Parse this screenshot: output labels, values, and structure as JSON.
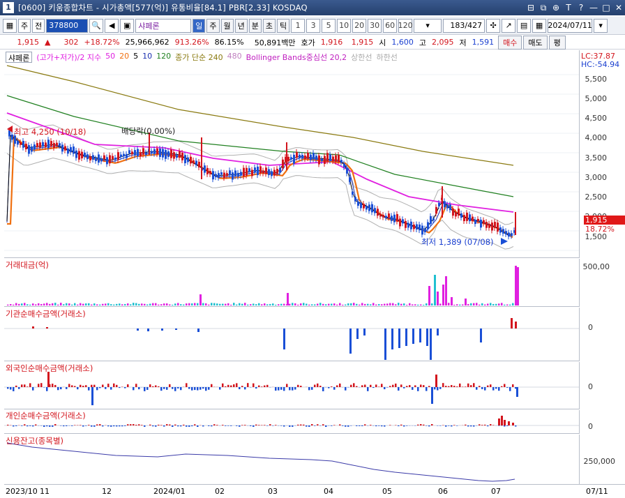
{
  "window": {
    "number": "1",
    "title": "[0600] 키움종합차트 - 시가총액[577(억)] 유통비율[84.1] PBR[2.33] KOSDAQ",
    "buttons": [
      "⊟",
      "⧉",
      "⊕",
      "T",
      "?",
      "—",
      "□",
      "✕"
    ]
  },
  "toolbar": {
    "market": "주",
    "scope": "전",
    "code": "378800",
    "stock_name": "샤페론",
    "periods": [
      "일",
      "주",
      "월",
      "년",
      "분",
      "초",
      "틱"
    ],
    "active_period": "일",
    "intervals": [
      "1",
      "3",
      "5",
      "10",
      "20",
      "30",
      "60",
      "120"
    ],
    "count": "183",
    "count_total": "/427",
    "date": "2024/07/11"
  },
  "pricebar": {
    "price": "1,915",
    "arrow": "▲",
    "change": "302",
    "change_pct": "+18.72%",
    "volume": "25,966,962",
    "volume_ratio": "913.26%",
    "turnover": "86.15%",
    "amount": "50,891백만",
    "quote_label": "호가",
    "bid": "1,916",
    "ask": "1,915",
    "open_label": "시",
    "open": "1,600",
    "high_label": "고",
    "high": "2,095",
    "low_label": "저",
    "low": "1,591",
    "buy_label": "매수",
    "sell_label": "매도",
    "eval_label": "평"
  },
  "legend": {
    "name": "샤페론",
    "ma_label": "(고가+저가)/2 지수",
    "ma50": "50",
    "ma20": "20",
    "ma5": "5",
    "ma10": "10",
    "ma120": "120",
    "close_label": "종가 단순 240",
    "ma480": "480",
    "bb": "Bollinger Bands중심선 20,2",
    "upper": "상한선",
    "lower": "하한선"
  },
  "price_panel": {
    "lc": "LC:37.87",
    "hc": "HC:-54.94",
    "yticks": [
      "5,500",
      "5,000",
      "4,500",
      "4,000",
      "3,500",
      "3,000",
      "2,500",
      "2,000",
      "1,500"
    ],
    "current": "1,915",
    "current_pct": "18.72%",
    "high_note": "최고 4,250 (10/18)",
    "dividend_note": "배당락(0.00%)",
    "low_note": "최저 1,389 (07/08)"
  },
  "panels": {
    "amount": {
      "title": "거래대금(억)",
      "tick": "500,00"
    },
    "inst": {
      "title": "기관순매수금액(거래소)",
      "tick": "0"
    },
    "foreign": {
      "title": "외국인순매수금액(거래소)",
      "tick": "0"
    },
    "indiv": {
      "title": "개인순매수금액(거래소)",
      "tick": "0"
    },
    "credit": {
      "title": "신용잔고(종목별)",
      "tick": "250,000"
    }
  },
  "xaxis": {
    "labels": [
      "2023/10",
      "11",
      "12",
      "2024/01",
      "02",
      "03",
      "04",
      "05",
      "06",
      "07"
    ],
    "right": "07/11"
  },
  "colors": {
    "up": "#d3151d",
    "down": "#1a4fd6",
    "ma5": "#000000",
    "ma10": "#1a2fb0",
    "ma20": "#f07010",
    "ma50": "#e020e0",
    "ma120": "#208020",
    "ma240": "#8a7a10",
    "bb": "#b0b0b0"
  }
}
